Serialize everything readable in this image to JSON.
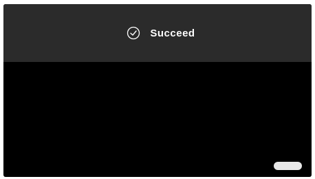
{
  "toast": {
    "icon": "check-circle-icon",
    "message": "Succeed"
  },
  "video": {
    "corner_button_label": "",
    "corner_button_icon": "play-pill-icon"
  },
  "colors": {
    "toast_background": "#2b2b2b",
    "screen_background": "#000000",
    "text": "#ffffff",
    "pill": "#e8e8e8"
  }
}
